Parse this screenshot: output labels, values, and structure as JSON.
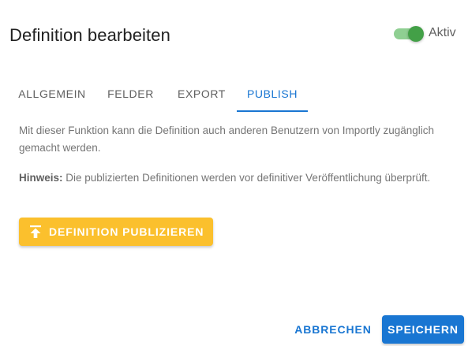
{
  "dialog": {
    "title": "Definition bearbeiten",
    "active_toggle": {
      "label": "Aktiv",
      "checked": true,
      "color": "#43a047"
    }
  },
  "tabs": [
    {
      "label": "ALLGEMEIN",
      "active": false
    },
    {
      "label": "FELDER",
      "active": false
    },
    {
      "label": "EXPORT",
      "active": false
    },
    {
      "label": "PUBLISH",
      "active": true
    }
  ],
  "publish_tab": {
    "description": "Mit dieser Funktion kann die Definition auch anderen Benutzern von Importly zugänglich gemacht werden.",
    "hint_label": "Hinweis:",
    "hint_text": " Die publizierten Definitionen werden vor definitiver Veröffentlichung überprüft.",
    "publish_button": {
      "label": "DEFINITION PUBLIZIEREN",
      "icon": "publish-icon",
      "color": "#fbc02d"
    }
  },
  "actions": {
    "cancel_label": "ABBRECHEN",
    "save_label": "SPEICHERN",
    "accent_color": "#1976d2"
  }
}
